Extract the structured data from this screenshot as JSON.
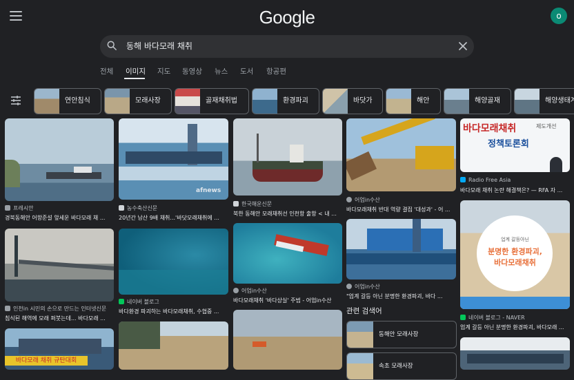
{
  "header": {
    "logo": "Google",
    "avatar_letter": "o"
  },
  "search": {
    "query": "동해 바다모래 채취"
  },
  "tabs": [
    "전체",
    "이미지",
    "지도",
    "동영상",
    "뉴스",
    "도서",
    "항공편"
  ],
  "chips": [
    "연안침식",
    "모래사장",
    "골재채취법",
    "환경파괴",
    "바닷가",
    "해안",
    "해양골재",
    "해양생태계"
  ],
  "results": [
    {
      "source": "프레시안",
      "caption": "경북동해안 어항준설 앞세운 바다모래 채 ..."
    },
    {
      "source": "농수축산신문",
      "caption": "20년간 남산 9배 채취...'바닷모래채취에 ..."
    },
    {
      "source": "한국해운신문",
      "caption": "북한 동해안 모래채취선 인천항 출항 < 내 ..."
    },
    {
      "source": "어업in수산",
      "caption": "바다모래채취 반대 역량 결집 '대성과' - 어 ..."
    },
    {
      "source": "Radio Free Asia",
      "caption": "바다모래 채취 논란 해결책은? — RFA 자 ..."
    },
    {
      "source": "인천in 시민의 손으로 만드는 인터넷신문",
      "caption": "침식된 해역에 모래 퍼붓는데... 바다모래 ..."
    },
    {
      "source": "네이버 블로그",
      "caption": "바다환경 파괴하는 바다모래채취, 수협중 ..."
    },
    {
      "source": "어업in수산",
      "caption": "바다모래채취 '바다상실' 주범 - 어업in수산"
    },
    {
      "source": "어업in수산",
      "caption": "\"업계 갈등 아닌 분명한 환경파괴, 바다 ..."
    },
    {
      "source": "네이버 블로그 - NAVER",
      "caption": "업계 갈등 아닌 분명한 환경파괴, 바다모래 ..."
    }
  ],
  "image_text": {
    "afnews": "afnews",
    "banner_red": "바다모래채취",
    "banner_small": "제도개선",
    "banner_blue": "정책토론회",
    "poster_small": "업계 갈등아닌",
    "poster_line1": "분명한 환경파괴,",
    "poster_line2": "바다모래채취",
    "sign": "바다모래 채취 규탄대회"
  },
  "related": {
    "heading": "관련 검색어",
    "items": [
      "동해안 모래사장",
      "속초 모래사장"
    ]
  },
  "colors": {
    "background": "#202124",
    "surface": "#303134",
    "border": "#5f6368",
    "avatar": "#0b8a74",
    "tab_active": "#e8eaed",
    "text_muted": "#9aa0a6"
  }
}
